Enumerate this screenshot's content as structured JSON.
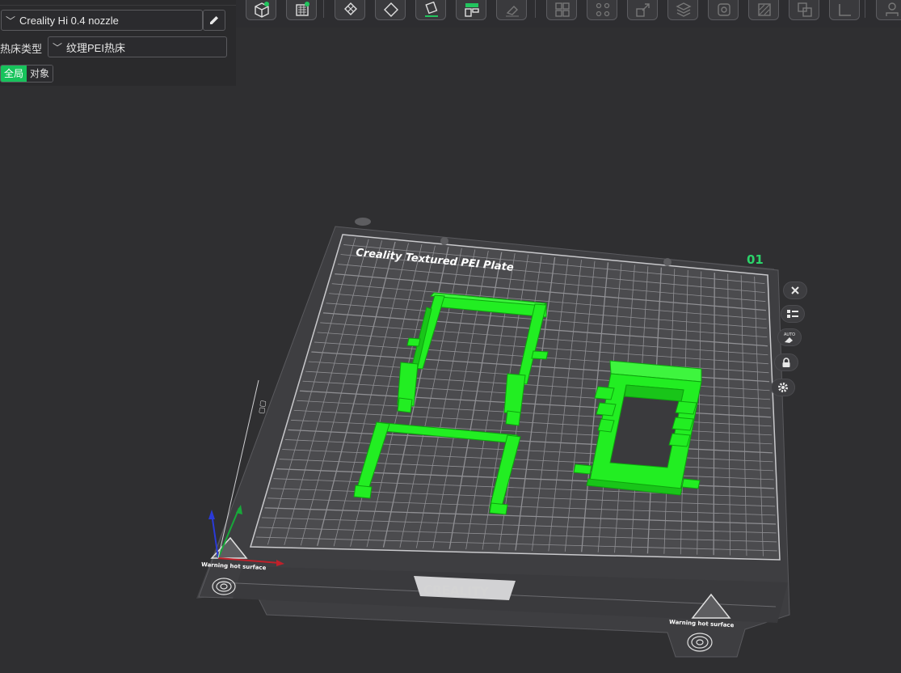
{
  "printer": {
    "name": "Creality Hi 0.4 nozzle"
  },
  "bed": {
    "label": "热床类型",
    "type": "纹理PEI热床"
  },
  "scope_toggle": {
    "global_label": "全局",
    "object_label": "对象",
    "active": "global"
  },
  "plate": {
    "title": "Creality Textured PEI Plate",
    "number": "01",
    "brand": "CREALITY",
    "warning_text": "Warning hot surface"
  },
  "colors": {
    "accent": "#17c35b",
    "model": "#22ee22",
    "background": "#2f2f31",
    "plate": "#4a4a4d",
    "grid": "#8a8a8e"
  },
  "toolbar": {
    "tools": [
      {
        "icon": "add-cube-icon"
      },
      {
        "icon": "add-plate-icon"
      },
      {
        "icon": "arrange-icon"
      },
      {
        "icon": "orient-icon"
      },
      {
        "icon": "fill-bed-icon"
      },
      {
        "icon": "layout-icon"
      },
      {
        "icon": "erase-icon"
      },
      {
        "icon": "split-objects-icon"
      },
      {
        "icon": "split-parts-icon"
      },
      {
        "icon": "scale-icon"
      },
      {
        "icon": "layers-icon"
      },
      {
        "icon": "support-paint-icon"
      },
      {
        "icon": "seam-paint-icon"
      },
      {
        "icon": "boolean-icon"
      },
      {
        "icon": "measure-icon"
      },
      {
        "icon": "assembly-icon"
      }
    ]
  },
  "plate_controls": {
    "close": {
      "icon": "close-icon"
    },
    "arrange": {
      "icon": "list-icon"
    },
    "auto_orient": {
      "icon": "auto-orient-icon",
      "label": "AUTO"
    },
    "lock": {
      "icon": "lock-icon"
    },
    "settings": {
      "icon": "gear-icon"
    }
  }
}
